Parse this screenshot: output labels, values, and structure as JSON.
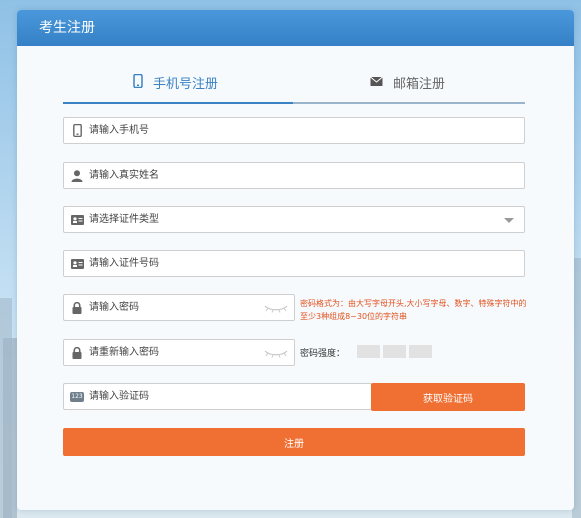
{
  "panel": {
    "title": "考生注册"
  },
  "tabs": [
    {
      "label": "手机号注册",
      "icon": "phone-icon",
      "active": true
    },
    {
      "label": "邮箱注册",
      "icon": "envelope-icon",
      "active": false
    }
  ],
  "form": {
    "phone": {
      "placeholder": "请输入手机号",
      "icon": "phone-icon"
    },
    "name": {
      "placeholder": "请输入真实姓名",
      "icon": "user-icon"
    },
    "id_type": {
      "placeholder": "请选择证件类型",
      "icon": "id-card-icon"
    },
    "id_number": {
      "placeholder": "请输入证件号码",
      "icon": "id-card-icon"
    },
    "password": {
      "placeholder": "请输入密码",
      "icon": "lock-icon",
      "trailing_icon": "eye-closed-icon"
    },
    "password_confirm": {
      "placeholder": "请重新输入密码",
      "icon": "lock-icon",
      "trailing_icon": "eye-closed-icon"
    },
    "code": {
      "placeholder": "请输入验证码",
      "icon_text": "123"
    }
  },
  "password_hint": "密码格式为：由大写字母开头,大小写字母、数字、特殊字符中的至少3种组成8~30位的字符串",
  "strength": {
    "label": "密码强度：",
    "levels": 3,
    "filled": 0
  },
  "buttons": {
    "get_code": "获取验证码",
    "register": "注册"
  },
  "colors": {
    "accent": "#3b82c4",
    "header": "#3a86cb",
    "action": "#f07033",
    "hint": "#e2521e"
  }
}
